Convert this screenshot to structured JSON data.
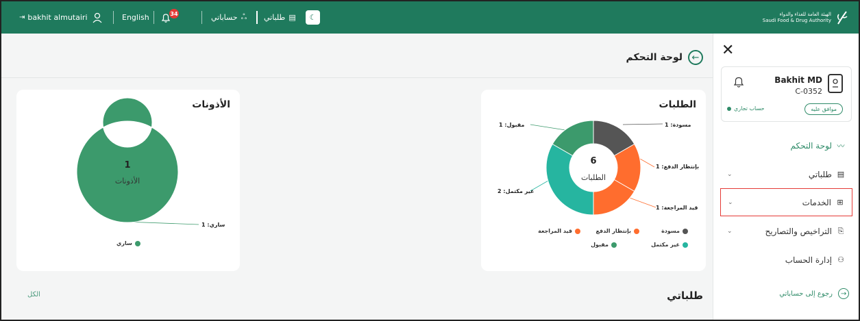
{
  "topbar": {
    "user_name": "bakhit almutairi",
    "language": "English",
    "notification_count": "34",
    "accounts_label": "حساباتي",
    "requests_label": "طلباتي",
    "logo_ar": "الهيئة العامة للغذاء والدواء",
    "logo_en": "Saudi Food & Drug Authority"
  },
  "header": {
    "title": "لوحة التحكم"
  },
  "requests_card": {
    "title": "الطلبات",
    "total": "6",
    "center_label": "الطلبات",
    "callouts": {
      "draft": "مسودة: 1",
      "awaiting_payment": "بإنتظار الدفع: 1",
      "under_review": "قيد المراجعة: 1",
      "incomplete": "غير مكتمل: 2",
      "accepted": "مقبول: 1"
    },
    "legend": [
      "مسودة",
      "بإنتظار الدفع",
      "قيد المراجعة",
      "غير مكتمل",
      "مقبول"
    ]
  },
  "permits_card": {
    "title": "الأذونات",
    "total": "1",
    "center_label": "الأذونات",
    "callout": "ساري: 1",
    "legend": [
      "ساري"
    ]
  },
  "chart_data": [
    {
      "type": "pie",
      "title": "الطلبات",
      "categories": [
        "مسودة",
        "بإنتظار الدفع",
        "قيد المراجعة",
        "غير مكتمل",
        "مقبول"
      ],
      "values": [
        1,
        1,
        1,
        2,
        1
      ],
      "colors": [
        "#555555",
        "#ff6d2e",
        "#ff6d2e",
        "#26b5a0",
        "#3c9a6c"
      ],
      "legend_position": "bottom"
    },
    {
      "type": "pie",
      "title": "الأذونات",
      "categories": [
        "ساري"
      ],
      "values": [
        1
      ],
      "colors": [
        "#3c9a6c"
      ],
      "legend_position": "bottom"
    }
  ],
  "section": {
    "my_requests": "طلباتي",
    "all_link": "الكل"
  },
  "sidebar": {
    "profile": {
      "name": "Bakhit MD",
      "id": "C-0352",
      "status": "موافق عليه",
      "account_type": "حساب تجاري"
    },
    "items": [
      {
        "label": "لوحة التحكم",
        "icon": "chart-line-icon"
      },
      {
        "label": "طلباتي",
        "icon": "list-icon"
      },
      {
        "label": "الخدمات",
        "icon": "grid-icon"
      },
      {
        "label": "التراخيص والتصاريح",
        "icon": "license-icon"
      },
      {
        "label": "إدارة الحساب",
        "icon": "user-icon"
      }
    ],
    "back_to_accounts": "رجوع إلى حساباتي"
  },
  "colors": {
    "brand": "#1f7a5d",
    "accent": "#2e8b68",
    "draft": "#555555",
    "orange": "#ff6d2e",
    "teal": "#26b5a0",
    "green": "#3c9a6c",
    "highlight_border": "#e53935"
  }
}
